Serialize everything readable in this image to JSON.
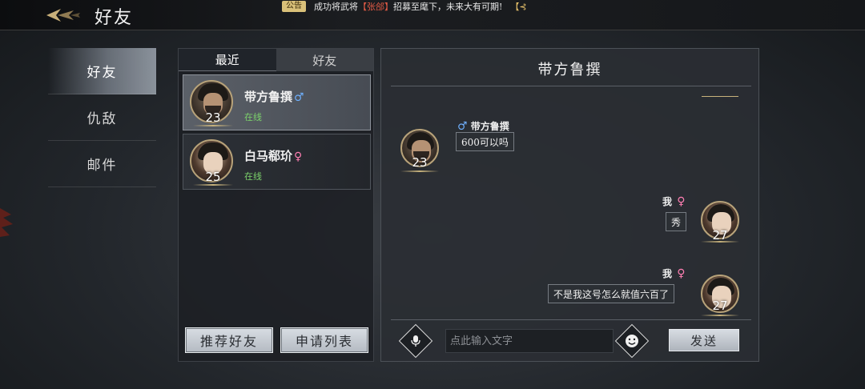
{
  "header": {
    "title": "好友",
    "notice": {
      "tag": "公告",
      "text_before": "成功将武将",
      "highlight_name": "【张郃】",
      "text_after": "招募至麾下，未来大有可期!",
      "tail": "【⊰"
    }
  },
  "nav": {
    "items": [
      {
        "label": "好友",
        "active": true
      },
      {
        "label": "仇敌",
        "active": false
      },
      {
        "label": "邮件",
        "active": false
      }
    ]
  },
  "friends_panel": {
    "tabs": [
      {
        "label": "最近",
        "active": true
      },
      {
        "label": "好友",
        "active": false
      }
    ],
    "list": [
      {
        "name": "带方鲁撰",
        "gender_icon": "♂",
        "status": "在线",
        "level": "23",
        "selected": true
      },
      {
        "name": "白马郗玠",
        "gender_icon": "♀",
        "status": "在线",
        "level": "25",
        "selected": false
      }
    ],
    "buttons": {
      "recommend": "推荐好友",
      "requests": "申请列表"
    }
  },
  "chat": {
    "title": "带方鲁撰",
    "messages": [
      {
        "sender": "带方鲁撰",
        "gender_icon": "♂",
        "text": "600可以吗",
        "level": "23",
        "side": "left"
      },
      {
        "sender": "我",
        "gender_icon": "♀",
        "text": "秀",
        "level": "27",
        "side": "right"
      },
      {
        "sender": "我",
        "gender_icon": "♀",
        "text": "不是我这号怎么就值六百了",
        "level": "27",
        "side": "right"
      }
    ],
    "input_placeholder": "点此输入文字",
    "send_label": "发送",
    "voice_icon": "microphone-icon",
    "emoji_icon": "smiley-icon"
  },
  "colors": {
    "online": "#7cd36b",
    "male": "#6fb0ff",
    "female": "#ff7fb3",
    "highlight": "#e25a45"
  }
}
